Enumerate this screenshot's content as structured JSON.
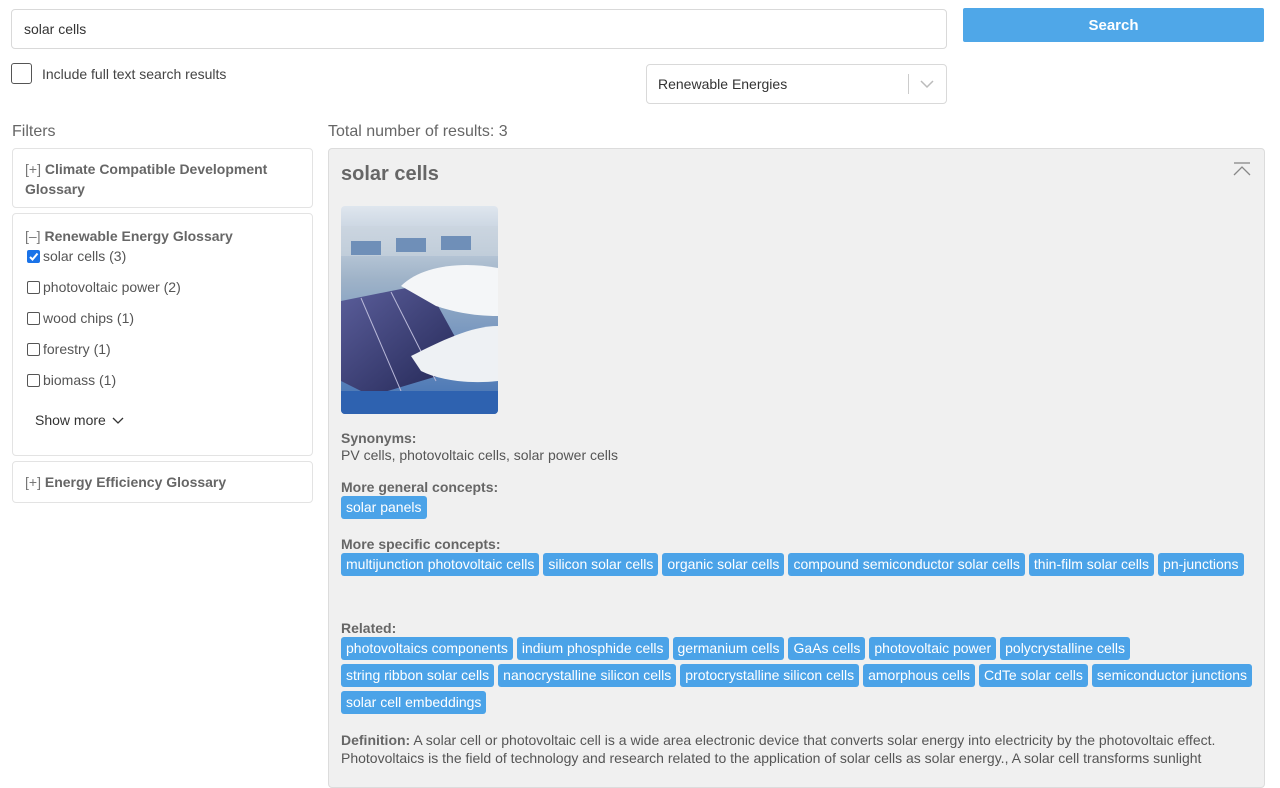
{
  "search": {
    "value": "solar cells",
    "button_label": "Search"
  },
  "fulltext_label": "Include full text search results",
  "domain_select": {
    "selected": "Renewable Energies"
  },
  "filters": {
    "title": "Filters",
    "groups": [
      {
        "toggle": "[+]",
        "name": "Climate Compatible Development Glossary"
      },
      {
        "toggle": "[–]",
        "name": "Renewable Energy Glossary",
        "items": [
          {
            "label": "solar cells (3)",
            "checked": true
          },
          {
            "label": "photovoltaic power (2)",
            "checked": false
          },
          {
            "label": "wood chips (1)",
            "checked": false
          },
          {
            "label": "forestry (1)",
            "checked": false
          },
          {
            "label": "biomass (1)",
            "checked": false
          }
        ],
        "show_more": "Show more"
      },
      {
        "toggle": "[+]",
        "name": "Energy Efficiency Glossary"
      }
    ]
  },
  "results": {
    "count_text": "Total number of results: 3",
    "card": {
      "title": "solar cells",
      "synonyms_label": "Synonyms:",
      "synonyms": "PV cells, photovoltaic cells, solar power cells",
      "general_label": "More general concepts:",
      "general": [
        "solar panels"
      ],
      "specific_label": "More specific concepts:",
      "specific": [
        "multijunction photovoltaic cells",
        "silicon solar cells",
        "organic solar cells",
        "compound semiconductor solar cells",
        "thin-film solar cells",
        "pn-junctions"
      ],
      "related_label": "Related:",
      "related": [
        "photovoltaics components",
        "indium phosphide cells",
        "germanium cells",
        "GaAs cells",
        "photovoltaic power",
        "polycrystalline cells",
        "string ribbon solar cells",
        "nanocrystalline silicon cells",
        "protocrystalline silicon cells",
        "amorphous cells",
        "CdTe solar cells",
        "semiconductor junctions",
        "solar cell embeddings"
      ],
      "definition_label": "Definition:",
      "definition": "A solar cell or photovoltaic cell is a wide area electronic device that converts solar energy into electricity by the photovoltaic effect. Photovoltaics is the field of technology and research related to the application of solar cells as solar energy., A solar cell transforms sunlight"
    }
  },
  "colors": {
    "accent": "#4fa7e8",
    "tag": "#4ba3e8",
    "card_bg": "#f0f0f0"
  }
}
